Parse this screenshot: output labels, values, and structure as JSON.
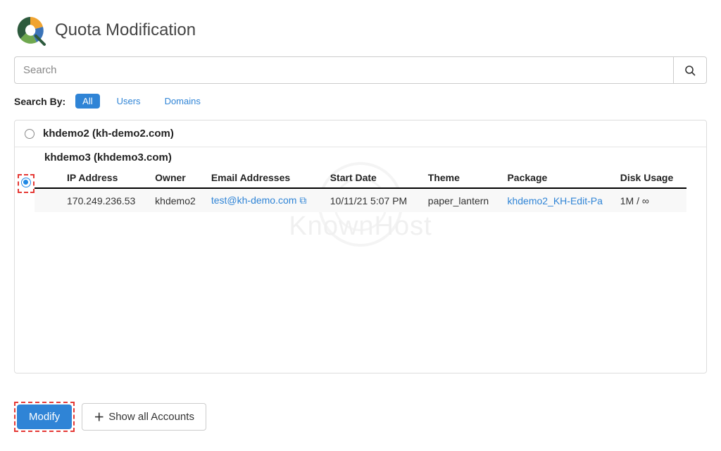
{
  "page": {
    "title": "Quota Modification"
  },
  "search": {
    "placeholder": "Search",
    "value": ""
  },
  "searchby": {
    "label": "Search By:",
    "options": {
      "all": "All",
      "users": "Users",
      "domains": "Domains"
    },
    "active": "all"
  },
  "watermark": "KnownHost",
  "accounts": [
    {
      "id": "khdemo2",
      "label": "khdemo2 (kh-demo2.com)",
      "selected": false
    },
    {
      "id": "khdemo3",
      "label": "khdemo3 (khdemo3.com)",
      "selected": true
    }
  ],
  "detail": {
    "headers": {
      "ip": "IP Address",
      "owner": "Owner",
      "email": "Email Addresses",
      "start": "Start Date",
      "theme": "Theme",
      "package": "Package",
      "disk": "Disk Usage"
    },
    "row": {
      "ip": "170.249.236.53",
      "owner": "khdemo2",
      "email": "test@kh-demo.com",
      "start": "10/11/21 5:07 PM",
      "theme": "paper_lantern",
      "package": "khdemo2_KH-Edit-Pa",
      "disk": "1M / ∞"
    }
  },
  "buttons": {
    "modify": "Modify",
    "show_all": "Show all Accounts"
  }
}
